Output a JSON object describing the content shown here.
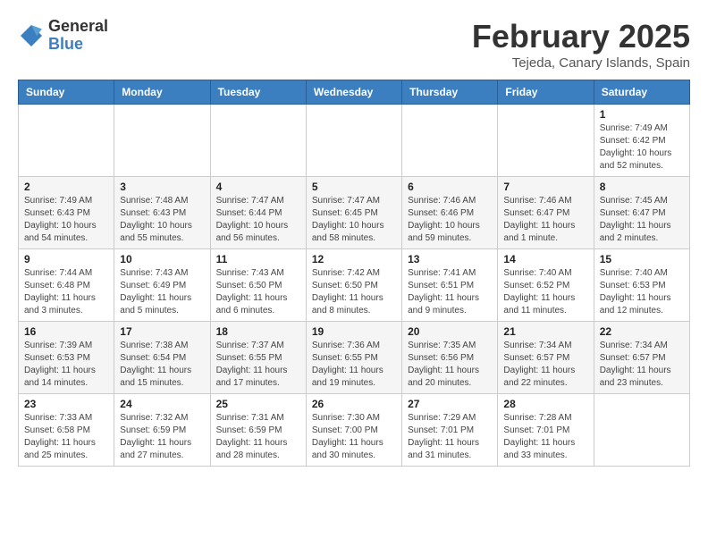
{
  "header": {
    "logo": {
      "general": "General",
      "blue": "Blue"
    },
    "title": "February 2025",
    "subtitle": "Tejeda, Canary Islands, Spain"
  },
  "calendar": {
    "weekdays": [
      "Sunday",
      "Monday",
      "Tuesday",
      "Wednesday",
      "Thursday",
      "Friday",
      "Saturday"
    ],
    "weeks": [
      [
        {
          "day": "",
          "info": ""
        },
        {
          "day": "",
          "info": ""
        },
        {
          "day": "",
          "info": ""
        },
        {
          "day": "",
          "info": ""
        },
        {
          "day": "",
          "info": ""
        },
        {
          "day": "",
          "info": ""
        },
        {
          "day": "1",
          "info": "Sunrise: 7:49 AM\nSunset: 6:42 PM\nDaylight: 10 hours\nand 52 minutes."
        }
      ],
      [
        {
          "day": "2",
          "info": "Sunrise: 7:49 AM\nSunset: 6:43 PM\nDaylight: 10 hours\nand 54 minutes."
        },
        {
          "day": "3",
          "info": "Sunrise: 7:48 AM\nSunset: 6:43 PM\nDaylight: 10 hours\nand 55 minutes."
        },
        {
          "day": "4",
          "info": "Sunrise: 7:47 AM\nSunset: 6:44 PM\nDaylight: 10 hours\nand 56 minutes."
        },
        {
          "day": "5",
          "info": "Sunrise: 7:47 AM\nSunset: 6:45 PM\nDaylight: 10 hours\nand 58 minutes."
        },
        {
          "day": "6",
          "info": "Sunrise: 7:46 AM\nSunset: 6:46 PM\nDaylight: 10 hours\nand 59 minutes."
        },
        {
          "day": "7",
          "info": "Sunrise: 7:46 AM\nSunset: 6:47 PM\nDaylight: 11 hours\nand 1 minute."
        },
        {
          "day": "8",
          "info": "Sunrise: 7:45 AM\nSunset: 6:47 PM\nDaylight: 11 hours\nand 2 minutes."
        }
      ],
      [
        {
          "day": "9",
          "info": "Sunrise: 7:44 AM\nSunset: 6:48 PM\nDaylight: 11 hours\nand 3 minutes."
        },
        {
          "day": "10",
          "info": "Sunrise: 7:43 AM\nSunset: 6:49 PM\nDaylight: 11 hours\nand 5 minutes."
        },
        {
          "day": "11",
          "info": "Sunrise: 7:43 AM\nSunset: 6:50 PM\nDaylight: 11 hours\nand 6 minutes."
        },
        {
          "day": "12",
          "info": "Sunrise: 7:42 AM\nSunset: 6:50 PM\nDaylight: 11 hours\nand 8 minutes."
        },
        {
          "day": "13",
          "info": "Sunrise: 7:41 AM\nSunset: 6:51 PM\nDaylight: 11 hours\nand 9 minutes."
        },
        {
          "day": "14",
          "info": "Sunrise: 7:40 AM\nSunset: 6:52 PM\nDaylight: 11 hours\nand 11 minutes."
        },
        {
          "day": "15",
          "info": "Sunrise: 7:40 AM\nSunset: 6:53 PM\nDaylight: 11 hours\nand 12 minutes."
        }
      ],
      [
        {
          "day": "16",
          "info": "Sunrise: 7:39 AM\nSunset: 6:53 PM\nDaylight: 11 hours\nand 14 minutes."
        },
        {
          "day": "17",
          "info": "Sunrise: 7:38 AM\nSunset: 6:54 PM\nDaylight: 11 hours\nand 15 minutes."
        },
        {
          "day": "18",
          "info": "Sunrise: 7:37 AM\nSunset: 6:55 PM\nDaylight: 11 hours\nand 17 minutes."
        },
        {
          "day": "19",
          "info": "Sunrise: 7:36 AM\nSunset: 6:55 PM\nDaylight: 11 hours\nand 19 minutes."
        },
        {
          "day": "20",
          "info": "Sunrise: 7:35 AM\nSunset: 6:56 PM\nDaylight: 11 hours\nand 20 minutes."
        },
        {
          "day": "21",
          "info": "Sunrise: 7:34 AM\nSunset: 6:57 PM\nDaylight: 11 hours\nand 22 minutes."
        },
        {
          "day": "22",
          "info": "Sunrise: 7:34 AM\nSunset: 6:57 PM\nDaylight: 11 hours\nand 23 minutes."
        }
      ],
      [
        {
          "day": "23",
          "info": "Sunrise: 7:33 AM\nSunset: 6:58 PM\nDaylight: 11 hours\nand 25 minutes."
        },
        {
          "day": "24",
          "info": "Sunrise: 7:32 AM\nSunset: 6:59 PM\nDaylight: 11 hours\nand 27 minutes."
        },
        {
          "day": "25",
          "info": "Sunrise: 7:31 AM\nSunset: 6:59 PM\nDaylight: 11 hours\nand 28 minutes."
        },
        {
          "day": "26",
          "info": "Sunrise: 7:30 AM\nSunset: 7:00 PM\nDaylight: 11 hours\nand 30 minutes."
        },
        {
          "day": "27",
          "info": "Sunrise: 7:29 AM\nSunset: 7:01 PM\nDaylight: 11 hours\nand 31 minutes."
        },
        {
          "day": "28",
          "info": "Sunrise: 7:28 AM\nSunset: 7:01 PM\nDaylight: 11 hours\nand 33 minutes."
        },
        {
          "day": "",
          "info": ""
        }
      ]
    ]
  }
}
